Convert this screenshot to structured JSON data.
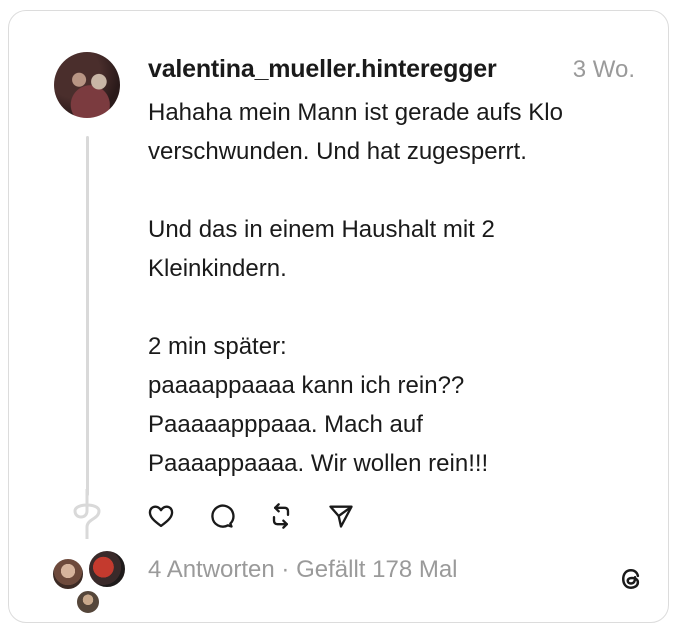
{
  "post": {
    "username": "valentina_mueller.hinteregger",
    "timestamp": "3 Wo.",
    "paragraphs": [
      [
        "Hahaha mein Mann ist gerade aufs Klo",
        "verschwunden. Und hat zugesperrt."
      ],
      [
        "Und das in einem Haushalt mit 2",
        "Kleinkindern."
      ],
      [
        "2 min später:",
        "paaaappaaaa kann ich rein??",
        "Paaaaapppaaa. Mach auf",
        "Paaaappaaaa. Wir wollen rein!!!"
      ]
    ]
  },
  "actions": {
    "icons": [
      "heart-icon",
      "comment-icon",
      "repost-icon",
      "share-icon"
    ]
  },
  "footer": {
    "replies": "4 Antworten",
    "separator": "·",
    "likes": "Gefällt 178 Mal",
    "logo_icon": "threads-logo-icon"
  }
}
